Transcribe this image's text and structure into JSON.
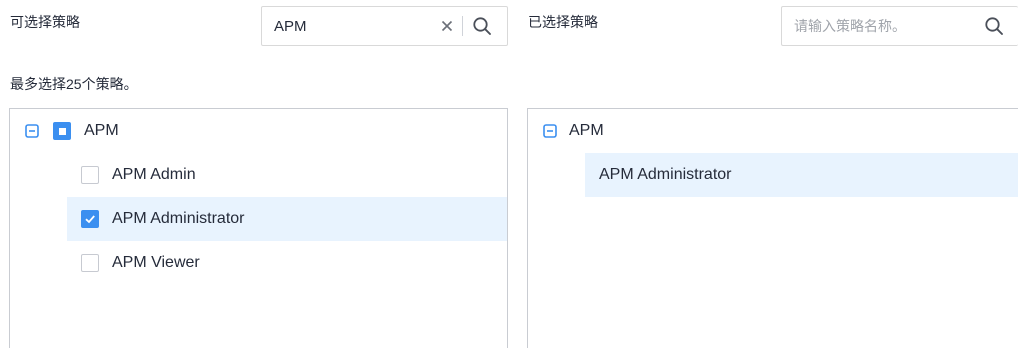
{
  "available": {
    "label": "可选择策略",
    "search_value": "APM",
    "hint": "最多选择25个策略。",
    "tree": {
      "group_label": "APM",
      "items": [
        {
          "label": "APM Admin",
          "checked": false
        },
        {
          "label": "APM Administrator",
          "checked": true
        },
        {
          "label": "APM Viewer",
          "checked": false
        }
      ]
    }
  },
  "selected": {
    "label": "已选择策略",
    "search_placeholder": "请输入策略名称。",
    "tree": {
      "group_label": "APM",
      "items": [
        {
          "label": "APM Administrator"
        }
      ]
    }
  },
  "colors": {
    "accent": "#3b8ff0",
    "selected_row": "#e8f3fe",
    "border": "#c9ccd2"
  },
  "icons": {
    "clear": "close-icon",
    "search": "search-icon",
    "collapse": "minus-square-icon"
  }
}
